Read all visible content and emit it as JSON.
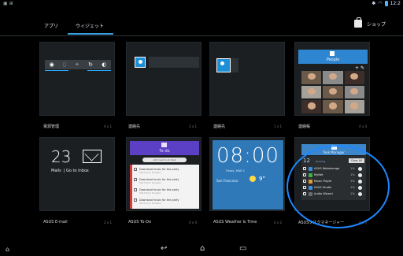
{
  "status_bar": {
    "left_icons": "▣ ⊞",
    "time": "12:2"
  },
  "tabs": [
    {
      "label": "アプリ"
    },
    {
      "label": "ウィジェット"
    }
  ],
  "store_label": "ショップ",
  "widgets": [
    {
      "label": "電源管理",
      "size": "4 x 1"
    },
    {
      "label": "連絡先",
      "size": "3 x 1"
    },
    {
      "label": "連絡先",
      "size": "1 x 1"
    },
    {
      "label": "連絡帳",
      "size": "4 x 4"
    },
    {
      "label": "ASUS E-mail",
      "size": "2 x 1"
    },
    {
      "label": "ASUS To-Do",
      "size": "4 x 4"
    },
    {
      "label": "ASUS Weather & Time",
      "size": "4 x 2"
    },
    {
      "label": "ASUSタスクマネージャー",
      "size": "4 x 4"
    }
  ],
  "people_widget": {
    "title": "People",
    "tools": "+ ✎"
  },
  "email_widget": {
    "count": "23",
    "mails_label": "Mails",
    "goto_label": "Go to Inbox"
  },
  "todo_widget": {
    "title": "To-do",
    "add_placeholder": "Add new to-do task",
    "items": [
      {
        "title": "Download music for the party",
        "sub": "Fetch from Dropbox"
      },
      {
        "title": "Download music for the party",
        "sub": "Fetch from Dropbox"
      },
      {
        "title": "Download music for the party",
        "sub": "Fetch from Dropbox"
      },
      {
        "title": "Download music for the party",
        "sub": "Fetch from Dropbox"
      }
    ]
  },
  "weather_widget": {
    "time": "08:00",
    "date": "Friday, MAR 1",
    "location": "San Francisco",
    "temp": "9°"
  },
  "task_manager_widget": {
    "title": "Task Manager",
    "count": "12",
    "count_label": "Running",
    "clear_all": "Clear All",
    "apps": [
      {
        "name": "ASUS Webstorage",
        "pct": "1%",
        "color": "#3a8ee0"
      },
      {
        "name": "MyNet",
        "pct": "1%",
        "color": "#3fb24a"
      },
      {
        "name": "Music Player",
        "pct": "1%",
        "color": "#e0a030"
      },
      {
        "name": "ASUS Studio",
        "pct": "1%",
        "color": "#3a8ee0"
      },
      {
        "name": "Audio Wizard",
        "pct": "1%",
        "color": "#6c6c6c"
      }
    ]
  },
  "colors": {
    "accent": "#3aa0e6",
    "highlight_ring": "#1e88ff",
    "tile_bg": "#1b1f22"
  },
  "nav": {
    "back_icon": "back-icon",
    "home_icon": "home-icon",
    "recents_icon": "recents-icon"
  }
}
